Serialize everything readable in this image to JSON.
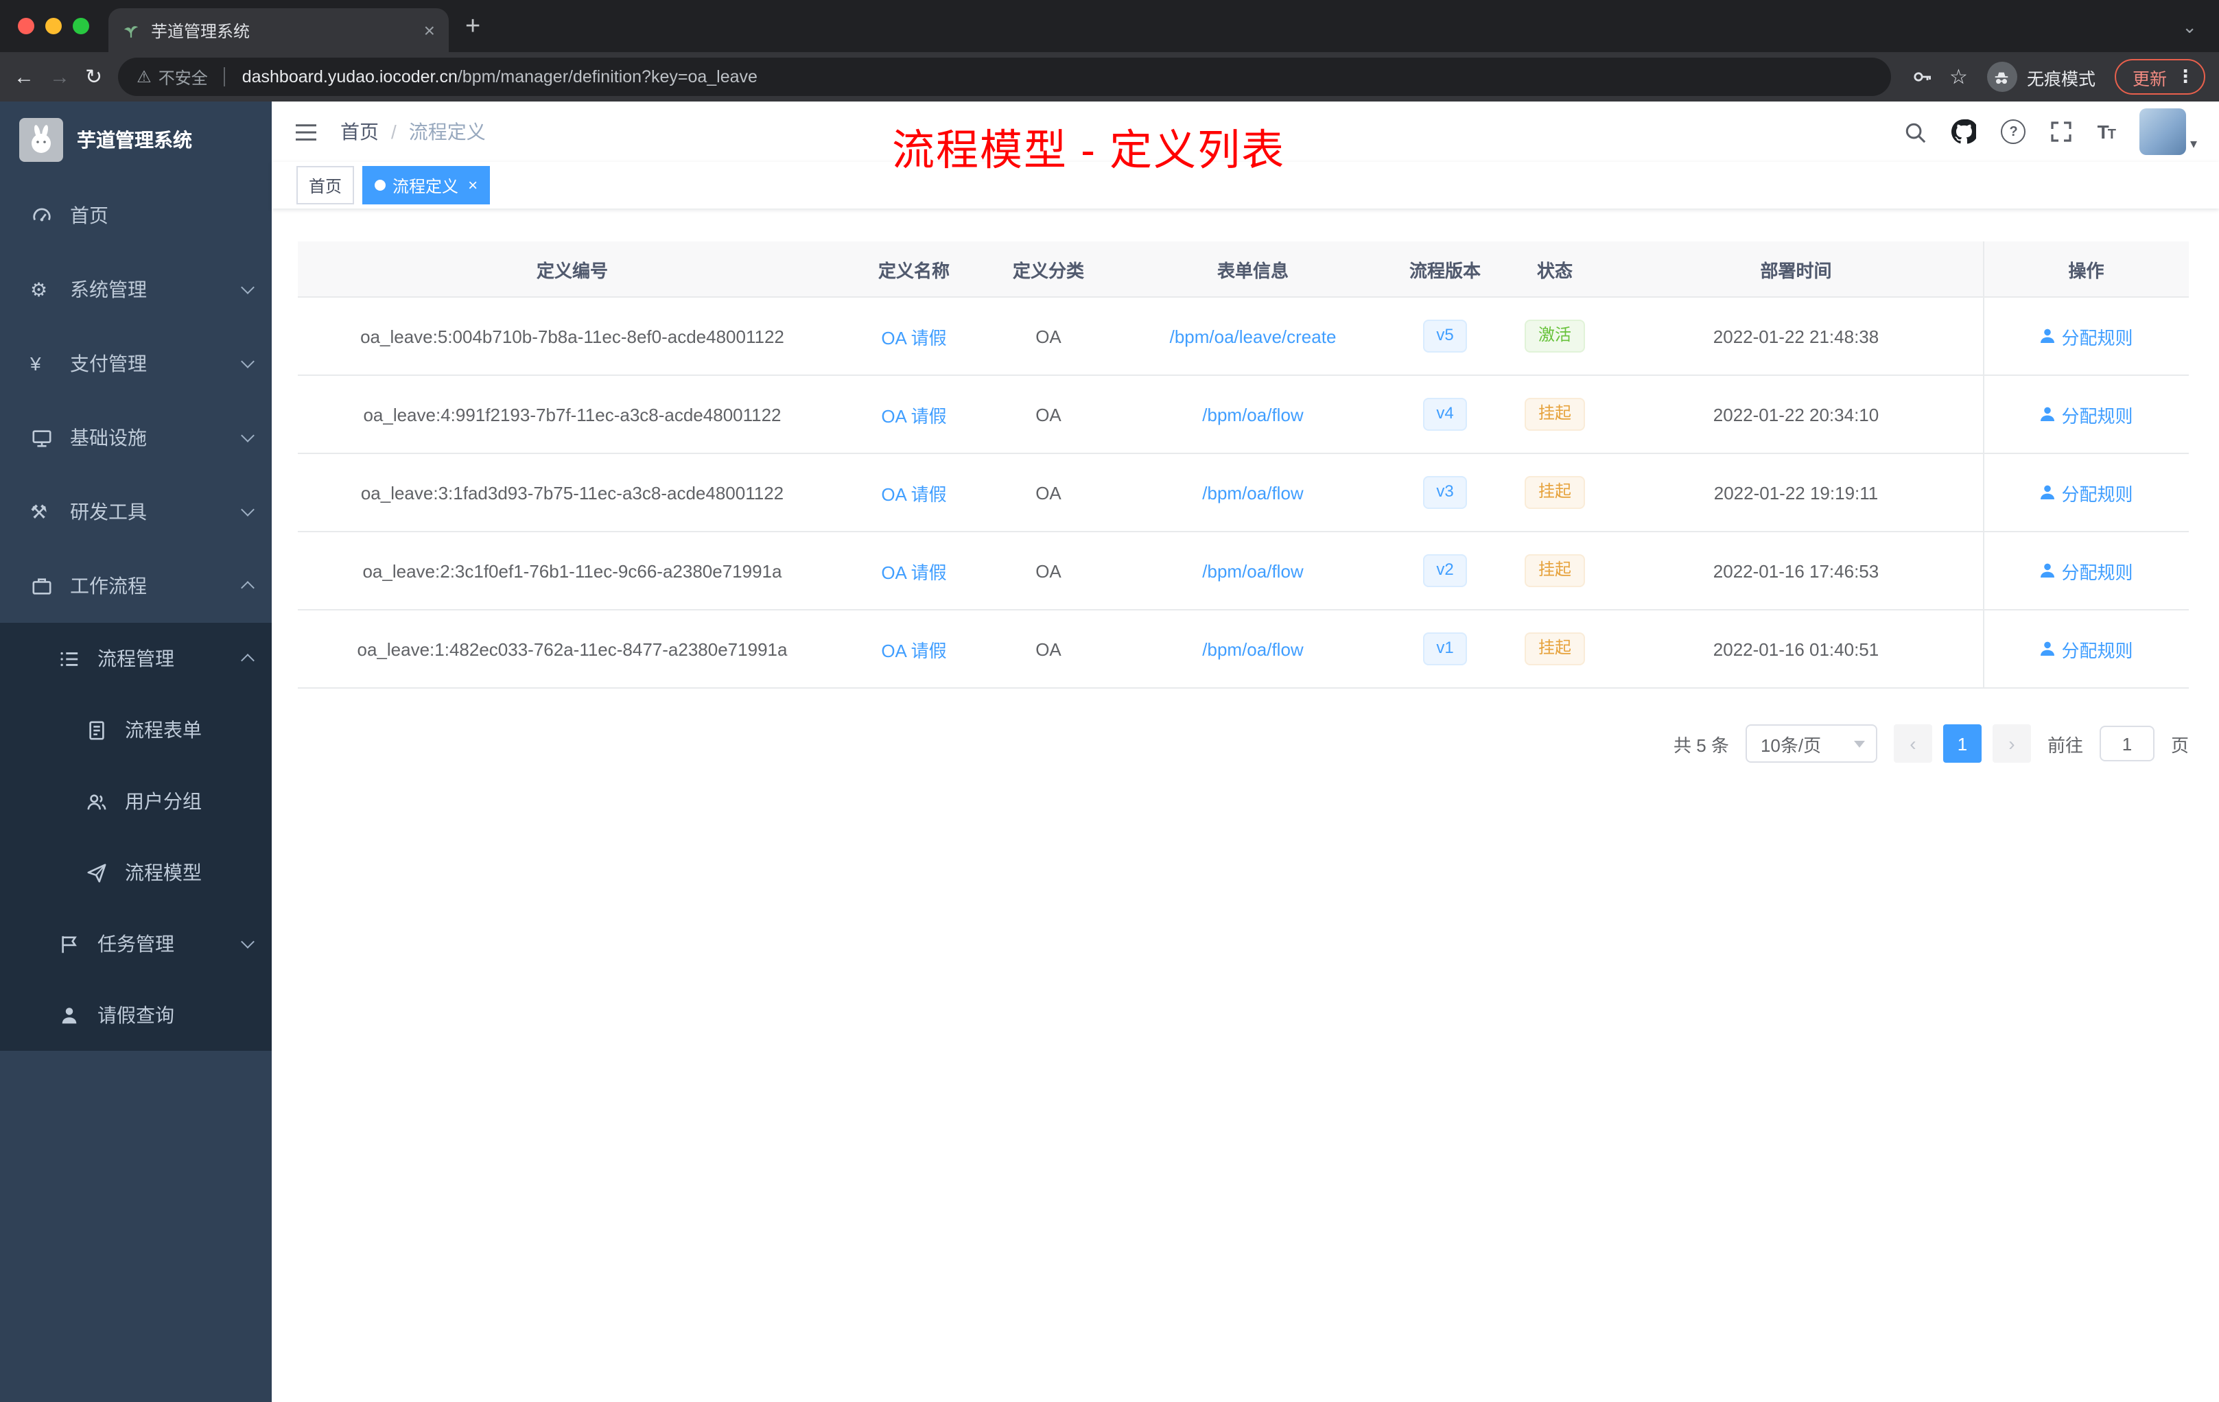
{
  "colors": {
    "accent": "#409eff",
    "success": "#67c23a",
    "warning": "#e6a23c",
    "annotation_red": "#ff0000",
    "sidebar_bg": "#304156",
    "submenu_bg": "#1f2d3d"
  },
  "icons": {
    "gear-icon": "⚙",
    "yen-icon": "¥",
    "tools-icon": "⚒",
    "star-icon": "☆",
    "warning-icon": "⚠",
    "plus-icon": "+",
    "back-icon": "←",
    "forward-icon": "→",
    "reload-icon": "↻",
    "chevron-down-icon": "⌄",
    "chevron-left-icon": "‹",
    "chevron-right-icon": "›",
    "close-icon": "×",
    "more-icon": "⋮",
    "caret-down-icon": "▾"
  },
  "browser": {
    "tab_title": "芋道管理系统",
    "security_label": "不安全",
    "url_domain": "dashboard.yudao.iocoder.cn",
    "url_path": "/bpm/manager/definition?key=oa_leave",
    "incognito_label": "无痕模式",
    "update_label": "更新"
  },
  "sidebar": {
    "logo_title": "芋道管理系统",
    "menu": [
      {
        "label": "首页"
      },
      {
        "label": "系统管理"
      },
      {
        "label": "支付管理"
      },
      {
        "label": "基础设施"
      },
      {
        "label": "研发工具"
      },
      {
        "label": "工作流程"
      }
    ],
    "submenu": [
      {
        "label": "流程管理"
      },
      {
        "label": "流程表单"
      },
      {
        "label": "用户分组"
      },
      {
        "label": "流程模型"
      },
      {
        "label": "任务管理"
      },
      {
        "label": "请假查询"
      }
    ]
  },
  "header": {
    "breadcrumb_home": "首页",
    "breadcrumb_separator": "/",
    "breadcrumb_current": "流程定义",
    "annotation": "流程模型 - 定义列表"
  },
  "tags": {
    "home": "首页",
    "current": "流程定义"
  },
  "table": {
    "columns": [
      "定义编号",
      "定义名称",
      "定义分类",
      "表单信息",
      "流程版本",
      "状态",
      "部署时间",
      "操作"
    ],
    "action_label": "分配规则",
    "rows": [
      {
        "id": "oa_leave:5:004b710b-7b8a-11ec-8ef0-acde48001122",
        "name": "OA 请假",
        "category": "OA",
        "form": "/bpm/oa/leave/create",
        "version": "v5",
        "status": "激活",
        "status_type": "success",
        "deploy_time": "2022-01-22 21:48:38"
      },
      {
        "id": "oa_leave:4:991f2193-7b7f-11ec-a3c8-acde48001122",
        "name": "OA 请假",
        "category": "OA",
        "form": "/bpm/oa/flow",
        "version": "v4",
        "status": "挂起",
        "status_type": "warning",
        "deploy_time": "2022-01-22 20:34:10"
      },
      {
        "id": "oa_leave:3:1fad3d93-7b75-11ec-a3c8-acde48001122",
        "name": "OA 请假",
        "category": "OA",
        "form": "/bpm/oa/flow",
        "version": "v3",
        "status": "挂起",
        "status_type": "warning",
        "deploy_time": "2022-01-22 19:19:11"
      },
      {
        "id": "oa_leave:2:3c1f0ef1-76b1-11ec-9c66-a2380e71991a",
        "name": "OA 请假",
        "category": "OA",
        "form": "/bpm/oa/flow",
        "version": "v2",
        "status": "挂起",
        "status_type": "warning",
        "deploy_time": "2022-01-16 17:46:53"
      },
      {
        "id": "oa_leave:1:482ec033-762a-11ec-8477-a2380e71991a",
        "name": "OA 请假",
        "category": "OA",
        "form": "/bpm/oa/flow",
        "version": "v1",
        "status": "挂起",
        "status_type": "warning",
        "deploy_time": "2022-01-16 01:40:51"
      }
    ]
  },
  "pagination": {
    "total": "共 5 条",
    "page_size": "10条/页",
    "current_page": "1",
    "goto": "前往",
    "page_unit": "页"
  }
}
